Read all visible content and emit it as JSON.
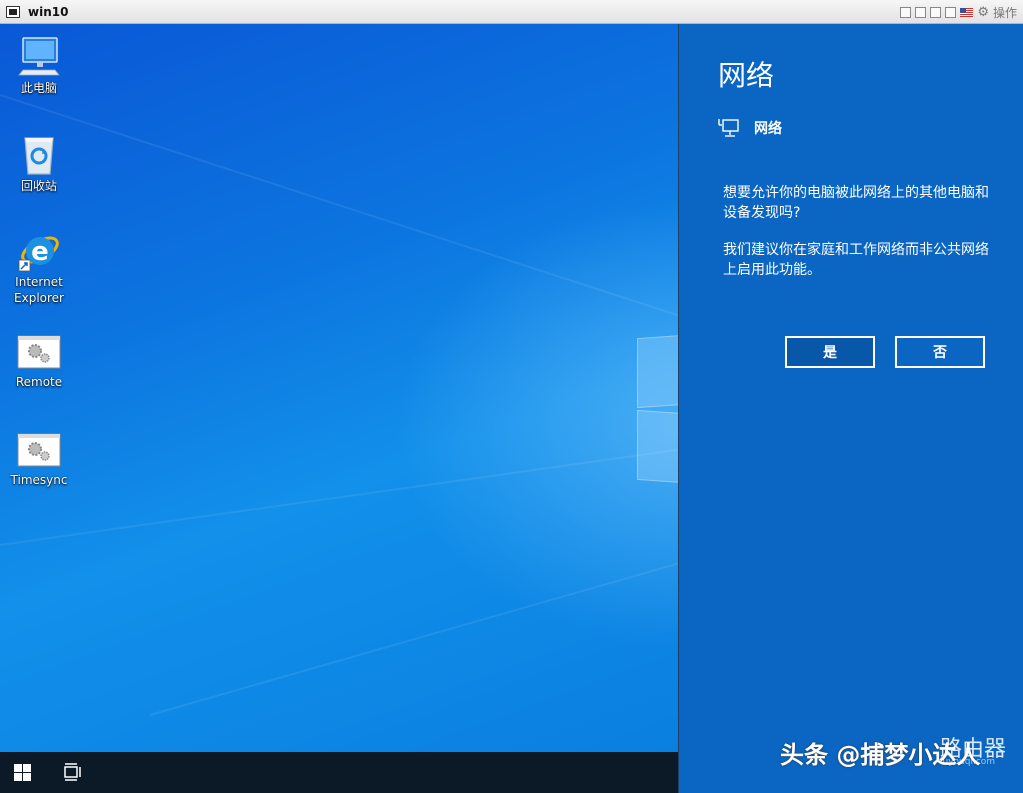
{
  "window": {
    "title": "win10",
    "action_label": "操作"
  },
  "desktop": {
    "icons": [
      {
        "label": "此电脑"
      },
      {
        "label": "回收站"
      },
      {
        "label_line1": "Internet",
        "label_line2": "Explorer"
      },
      {
        "label": "Remote"
      },
      {
        "label": "Timesync"
      }
    ]
  },
  "panel": {
    "title": "网络",
    "network_name": "网络",
    "question": "想要允许你的电脑被此网络上的其他电脑和设备发现吗?",
    "recommendation": "我们建议你在家庭和工作网络而非公共网络上启用此功能。",
    "yes_label": "是",
    "no_label": "否"
  },
  "watermark": {
    "text": "头条 @捕梦小达人",
    "brand": "路由器",
    "site": "luyouqi.com"
  },
  "colors": {
    "panel_bg": "#0a66c2",
    "taskbar_bg": "#0b1a26",
    "desktop_accent": "#0c74df"
  }
}
